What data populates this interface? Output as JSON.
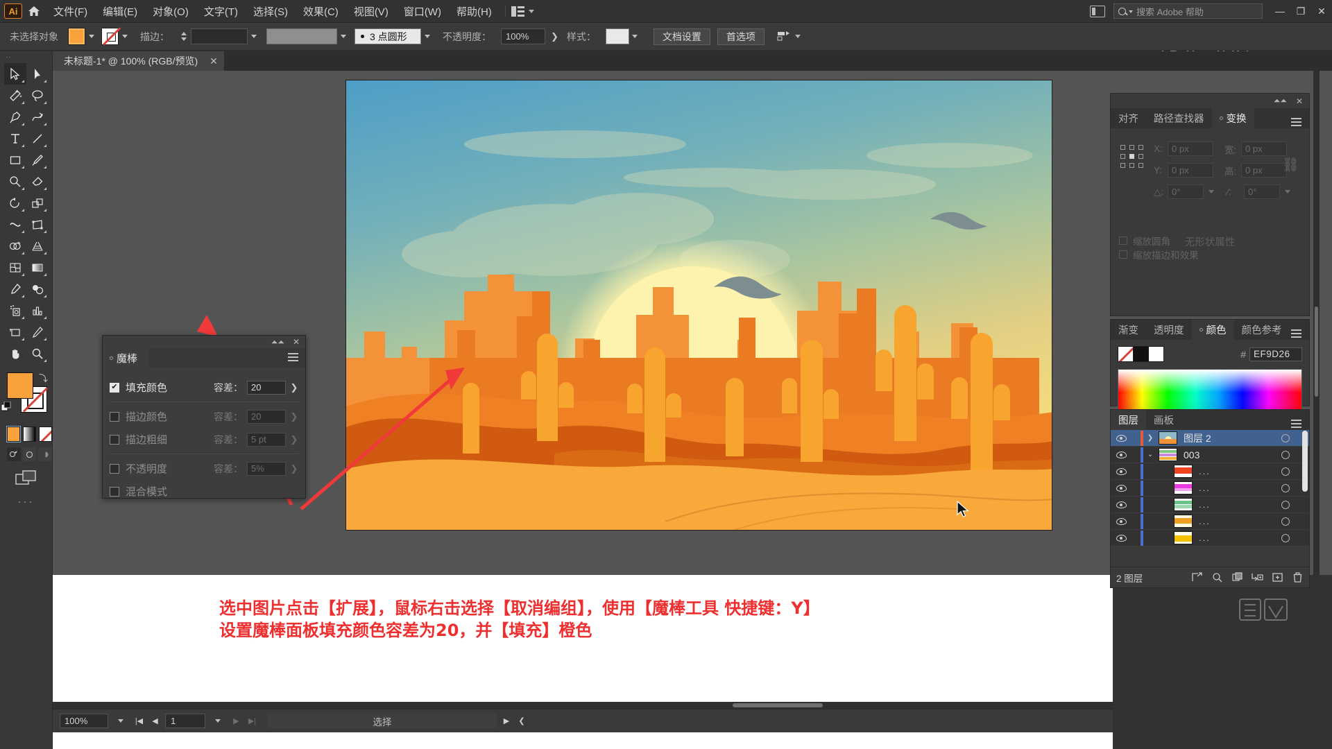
{
  "app": {
    "logo": "Ai",
    "home_icon": "home-icon"
  },
  "menubar": {
    "items": [
      "文件(F)",
      "编辑(E)",
      "对象(O)",
      "文字(T)",
      "选择(S)",
      "效果(C)",
      "视图(V)",
      "窗口(W)",
      "帮助(H)"
    ],
    "arrange_icon": "arrange-documents-icon",
    "panel_icon": "switch-workspace-icon",
    "search_placeholder": "搜索 Adobe 帮助",
    "search_icon": "search-icon",
    "minimize": "—",
    "maximize": "❐",
    "close": "✕"
  },
  "controlbar": {
    "selection_label": "未选择对象",
    "fill_swatch": "#F9A13A",
    "stroke_swatch": "none",
    "stroke_label": "描边：",
    "stroke_weight": "",
    "brush_value": "3 点圆形",
    "opacity_label": "不透明度：",
    "opacity_value": "100%",
    "style_label": "样式：",
    "doc_setup_button": "文档设置",
    "preferences_button": "首选项",
    "align_icon": "align-object-icon"
  },
  "toolbar": {
    "tools": [
      {
        "name": "selection-tool",
        "label": "选择工具"
      },
      {
        "name": "direct-selection-tool",
        "label": "直接选择工具"
      },
      {
        "name": "magic-wand-tool",
        "label": "魔棒工具"
      },
      {
        "name": "lasso-tool",
        "label": "套索工具"
      },
      {
        "name": "pen-tool",
        "label": "钢笔工具"
      },
      {
        "name": "curvature-tool",
        "label": "曲率工具"
      },
      {
        "name": "type-tool",
        "label": "文字工具"
      },
      {
        "name": "line-segment-tool",
        "label": "直线段工具"
      },
      {
        "name": "rectangle-tool",
        "label": "矩形工具"
      },
      {
        "name": "paintbrush-tool",
        "label": "画笔工具"
      },
      {
        "name": "shaper-tool",
        "label": "Shaper 工具"
      },
      {
        "name": "eraser-tool",
        "label": "橡皮擦工具"
      },
      {
        "name": "rotate-tool",
        "label": "旋转工具"
      },
      {
        "name": "scale-tool",
        "label": "比例缩放工具"
      },
      {
        "name": "width-tool",
        "label": "宽度工具"
      },
      {
        "name": "free-transform-tool",
        "label": "自由变换工具"
      },
      {
        "name": "shape-builder-tool",
        "label": "形状生成器工具"
      },
      {
        "name": "perspective-grid-tool",
        "label": "透视网格工具"
      },
      {
        "name": "mesh-tool",
        "label": "网格工具"
      },
      {
        "name": "gradient-tool",
        "label": "渐变工具"
      },
      {
        "name": "eyedropper-tool",
        "label": "吸管工具"
      },
      {
        "name": "blend-tool",
        "label": "混合工具"
      },
      {
        "name": "symbol-sprayer-tool",
        "label": "符号喷枪工具"
      },
      {
        "name": "column-graph-tool",
        "label": "柱形图工具"
      },
      {
        "name": "artboard-tool",
        "label": "画板工具"
      },
      {
        "name": "slice-tool",
        "label": "切片工具"
      },
      {
        "name": "hand-tool",
        "label": "抓手工具"
      },
      {
        "name": "zoom-tool",
        "label": "缩放工具"
      }
    ],
    "selected_tool": "selection-tool",
    "fill_color": "#F9A13A",
    "stroke_color": "none",
    "more_tools": "···"
  },
  "document_tab": {
    "title": "未标题-1* @ 100% (RGB/预览)",
    "close_icon": "close-icon"
  },
  "wand_panel": {
    "title": "魔棒",
    "menu_icon": "panel-menu-icon",
    "collapse_icon": "collapse-icon",
    "close_icon": "close-icon",
    "rows": [
      {
        "label": "填充颜色",
        "checked": true,
        "tol_label": "容差：",
        "tol_value": "20",
        "enabled": true
      },
      {
        "label": "描边颜色",
        "checked": false,
        "tol_label": "容差：",
        "tol_value": "20",
        "enabled": false
      },
      {
        "label": "描边粗细",
        "checked": false,
        "tol_label": "容差：",
        "tol_value": "5 pt",
        "enabled": false
      },
      {
        "label": "不透明度",
        "checked": false,
        "tol_label": "容差：",
        "tol_value": "5%",
        "enabled": false
      },
      {
        "label": "混合模式",
        "checked": false,
        "tol_label": "",
        "tol_value": "",
        "enabled": false
      }
    ]
  },
  "transform_panel": {
    "tabs": [
      {
        "label": "对齐",
        "active": false
      },
      {
        "label": "路径查找器",
        "active": false
      },
      {
        "label": "变换",
        "active": true
      }
    ],
    "reference_point": "center",
    "fields": [
      {
        "label": "X:",
        "value": "0 px"
      },
      {
        "label": "宽:",
        "value": "0 px"
      },
      {
        "label": "Y:",
        "value": "0 px"
      },
      {
        "label": "高:",
        "value": "0 px"
      }
    ],
    "angle_label": "△:",
    "angle_value": "0°",
    "shear_label": "∕:",
    "shear_value": "0°",
    "link_icon": "constrain-proportions-icon",
    "no_props_text": "无形状属性",
    "checkboxes": [
      "缩放圆角",
      "缩放描边和效果"
    ]
  },
  "color_panel": {
    "tabs": [
      {
        "label": "渐变",
        "active": false
      },
      {
        "label": "透明度",
        "active": false
      },
      {
        "label": "颜色",
        "active": true
      },
      {
        "label": "颜色参考",
        "active": false
      }
    ],
    "hash": "#",
    "hex_value": "EF9D26",
    "swatches": [
      "none",
      "#111111",
      "#FFFFFF"
    ],
    "menu_icon": "panel-menu-icon"
  },
  "layers_panel": {
    "tabs": [
      {
        "label": "图层",
        "active": true
      },
      {
        "label": "画板",
        "active": false
      }
    ],
    "rows": [
      {
        "name": "图层 2",
        "selected": true,
        "indent": 0,
        "color": "#e35b3b",
        "twist": "chevron-right-icon",
        "thumb": "artwork-thumb",
        "visible": true
      },
      {
        "name": "003",
        "selected": false,
        "indent": 1,
        "color": "#4a6fd0",
        "twist": "chevron-down-icon",
        "thumb": "group-thumb",
        "visible": true
      },
      {
        "name": "...",
        "selected": false,
        "indent": 2,
        "color": "#4a6fd0",
        "twist": "",
        "thumb": "path-thumb-red",
        "visible": true
      },
      {
        "name": "...",
        "selected": false,
        "indent": 2,
        "color": "#4a6fd0",
        "twist": "",
        "thumb": "path-thumb-magenta",
        "visible": true
      },
      {
        "name": "...",
        "selected": false,
        "indent": 2,
        "color": "#4a6fd0",
        "twist": "",
        "thumb": "path-thumb-green",
        "visible": true
      },
      {
        "name": "...",
        "selected": false,
        "indent": 2,
        "color": "#4a6fd0",
        "twist": "",
        "thumb": "path-thumb-orange",
        "visible": true
      },
      {
        "name": "...",
        "selected": false,
        "indent": 2,
        "color": "#4a6fd0",
        "twist": "",
        "thumb": "path-thumb-yellow",
        "visible": true
      }
    ],
    "footer_count": "2 图层",
    "footer_icons": [
      "locate-object-icon",
      "search-icon",
      "new-sublayer-icon",
      "make-clipping-mask-icon",
      "new-layer-icon",
      "delete-icon"
    ]
  },
  "statusbar": {
    "zoom_value": "100%",
    "page_value": "1",
    "status_text": "选择",
    "first_icon": "first-page-icon",
    "prev_icon": "prev-page-icon",
    "next_icon": "next-page-icon",
    "last_icon": "last-page-icon"
  },
  "annotation": {
    "line1": "选中图片点击【扩展】，鼠标右击选择【取消编组】，使用【魔棒工具 快捷键：Y】",
    "line2": "设置魔棒面板填充颜色容差为20，并【填充】橙色",
    "color": "#EE2F2F",
    "arrow1": "arrow-to-wand-panel",
    "arrow2": "arrow-to-canvas"
  },
  "artwork": {
    "description": "沙漠日落插画",
    "sky_top": "#4f9fc6",
    "sky_mid": "#8fc0b4",
    "sky_bottom": "#f5d97a",
    "sun_color": "#fbf0a8",
    "dune_light": "#f9a93c",
    "dune_mid": "#ef7f23",
    "dune_dark": "#cf5a10",
    "cactus_color": "#f7a52e",
    "mesa_color": "#f07d23",
    "bird_color": "#7a8b8e"
  }
}
